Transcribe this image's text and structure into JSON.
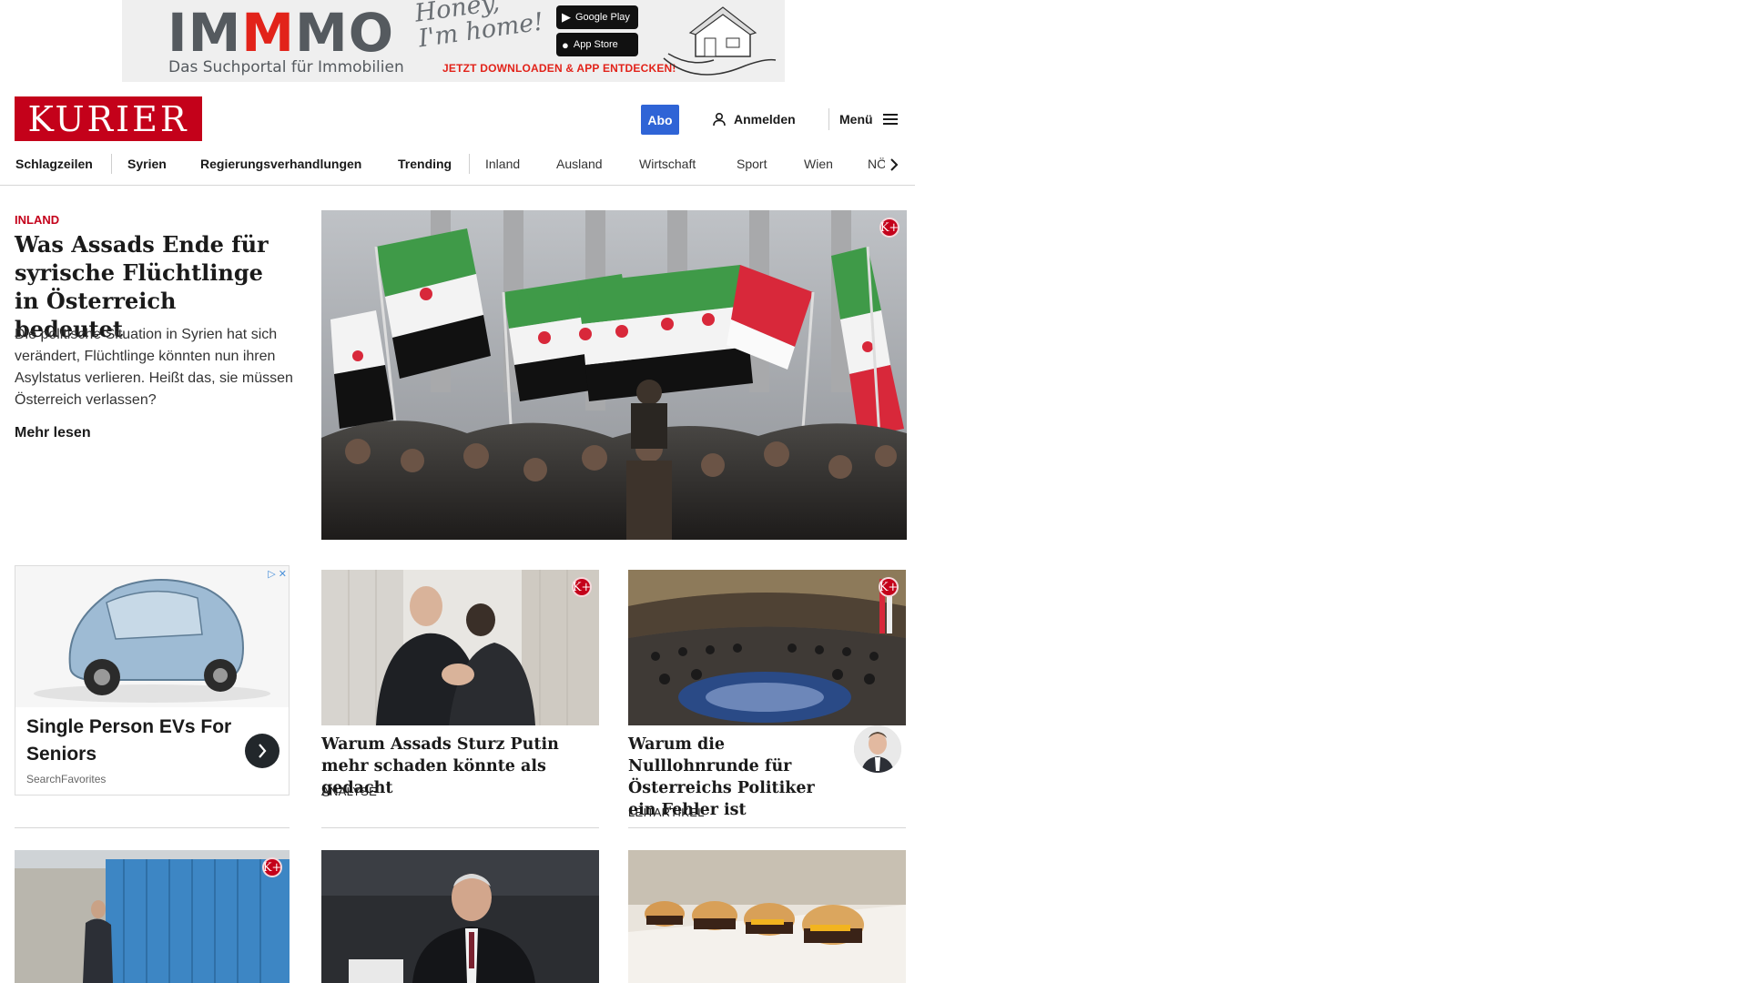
{
  "ad_banner": {
    "brand_pre": "IM",
    "brand_mid": "M",
    "brand_post": "MO",
    "tagline": "Das Suchportal für Immobilien",
    "slogan": "Honey, I'm home!",
    "google_play": "Google Play",
    "app_store": "App Store",
    "cta": "JETZT DOWNLOADEN & APP ENTDECKEN!"
  },
  "header": {
    "logo": "KURIER",
    "abo_label": "Abo",
    "login_label": "Anmelden",
    "menu_label": "Menü"
  },
  "nav": {
    "items": [
      "Schlagzeilen",
      "Syrien",
      "Regierungsverhandlungen",
      "Trending",
      "Inland",
      "Ausland",
      "Wirtschaft",
      "Sport",
      "Wien",
      "NÖ"
    ]
  },
  "hero": {
    "kicker": "INLAND",
    "title": "Was Assads Ende für sy­rische Flüchtlinge in Ös­terreich bedeutet",
    "teaser": "Die politische Situation in Syrien hat sich verändert, Flüchtlinge könnten nun ihren Asylstatus verlieren. Heißt das, sie müssen Österreich verlassen?",
    "more_label": "Mehr lesen",
    "badge": "K+"
  },
  "sponsored": {
    "title": "Single Person EVs For Seniors",
    "source": "SearchFavorites"
  },
  "cards": [
    {
      "title": "Warum Assads Sturz Putin mehr schaden könnte als gedacht",
      "tag": "ANALYSE",
      "badge": "K+"
    },
    {
      "title": "Warum die Nulllohnrunde für Österreichs Politiker ein Fehler ist",
      "tag": "LEITARTIKEL",
      "badge": "K+"
    }
  ],
  "bottom_row": {
    "badge": "K+"
  },
  "colors": {
    "brand_red": "#c4011a",
    "abo_blue": "#2f64d6"
  }
}
